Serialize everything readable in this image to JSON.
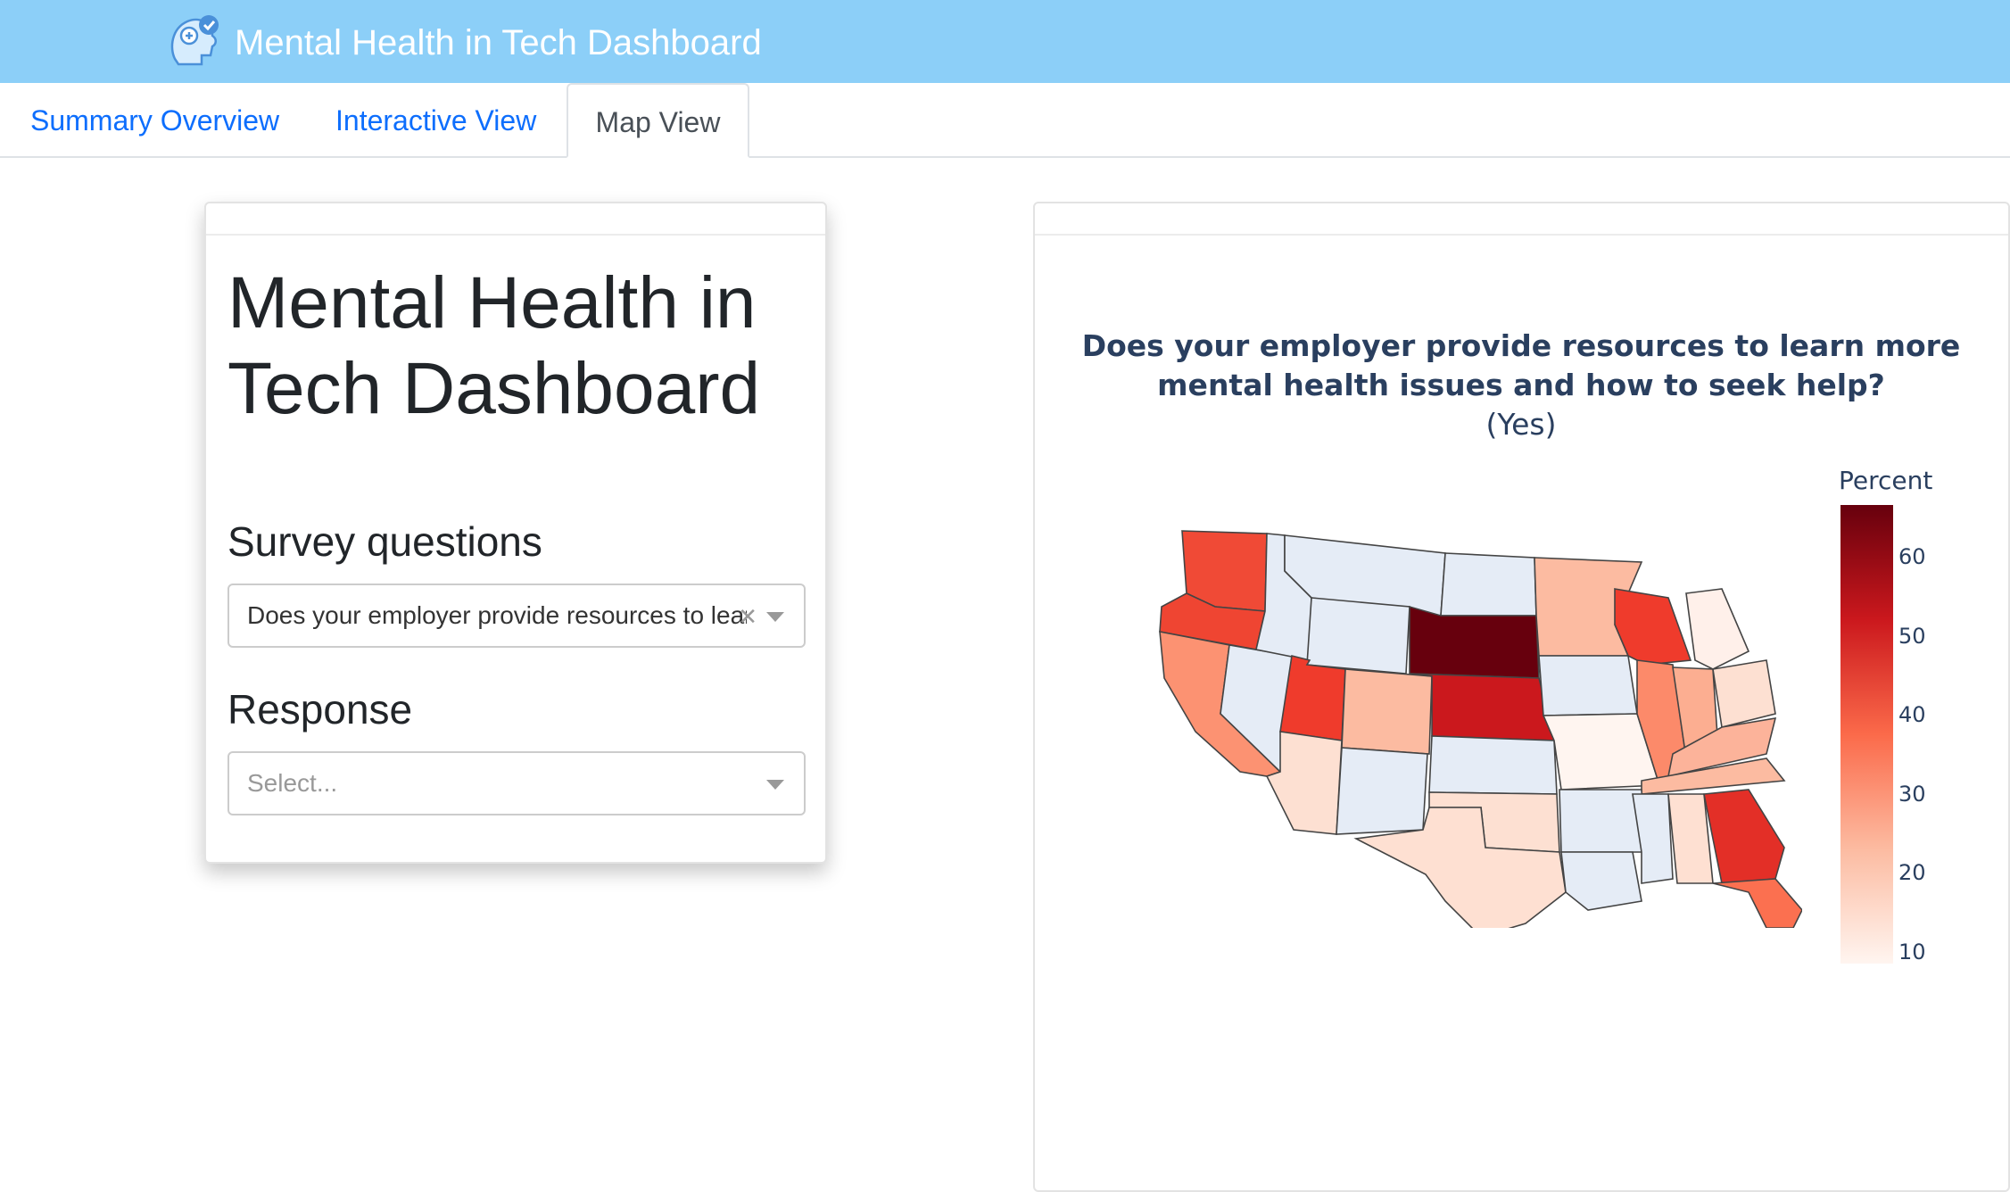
{
  "header": {
    "title": "Mental Health in Tech Dashboard",
    "logo_icon": "brain-check-icon"
  },
  "tabs": [
    {
      "label": "Summary Overview",
      "active": false
    },
    {
      "label": "Interactive View",
      "active": false
    },
    {
      "label": "Map View",
      "active": true
    }
  ],
  "sidebar": {
    "heading": "Mental Health in Tech Dashboard",
    "survey_label": "Survey questions",
    "survey_value": "Does your employer provide resources to learn more mental health issues and how to seek help?",
    "response_label": "Response",
    "response_placeholder": "Select..."
  },
  "map": {
    "title": "Does your employer provide resources to learn more mental health issues and how to seek help?",
    "subtitle": "(Yes)",
    "colorbar_title": "Percent",
    "colorbar_ticks": [
      "60",
      "50",
      "40",
      "30",
      "20",
      "10"
    ],
    "colorscale": [
      "#fff5f0",
      "#fcbba1",
      "#fb6a4a",
      "#cb181d",
      "#67000d"
    ],
    "no_data_color": "#e5ecf6"
  }
}
